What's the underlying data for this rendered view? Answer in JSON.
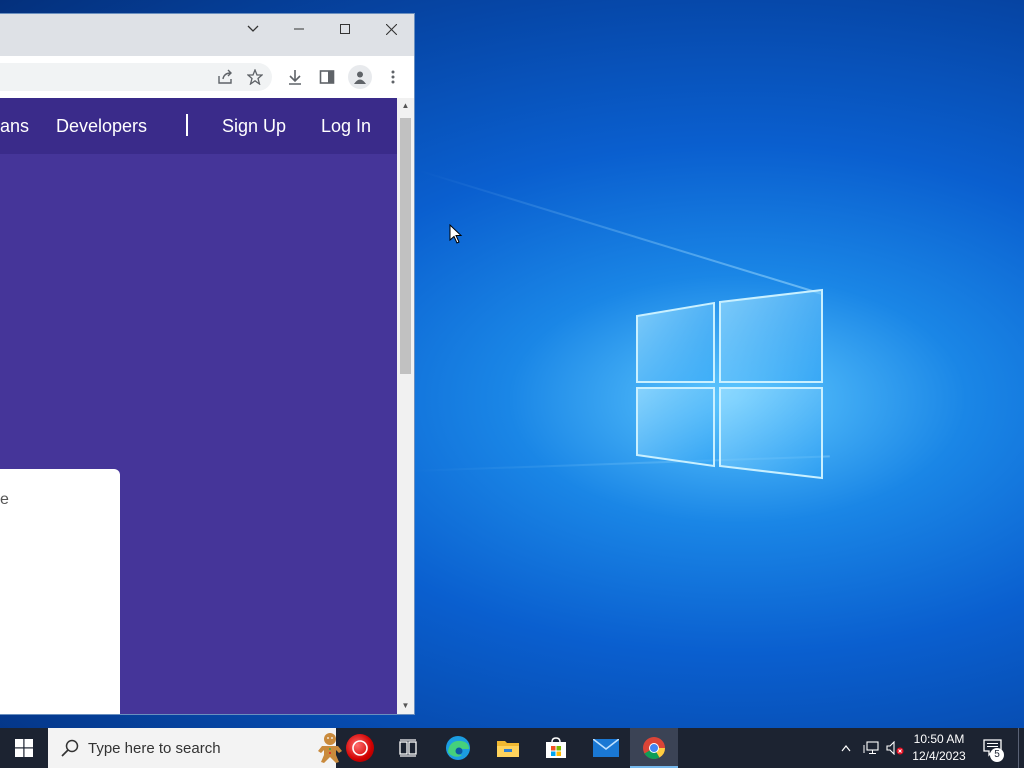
{
  "desktop": {
    "logo_icon": "windows-logo-icon"
  },
  "browser": {
    "controls": {
      "tab_search_icon": "chevron-down-icon",
      "minimize_icon": "minimize-icon",
      "maximize_icon": "maximize-icon",
      "close_icon": "close-icon"
    },
    "toolbar": {
      "share_icon": "share-icon",
      "bookmark_icon": "star-icon",
      "download_icon": "download-icon",
      "side_panel_icon": "side-panel-icon",
      "profile_icon": "profile-icon",
      "menu_icon": "kebab-menu-icon"
    },
    "site": {
      "nav_partial": "ans",
      "nav_developers": "Developers",
      "nav_signup": "Sign Up",
      "nav_login": "Log In",
      "card_text": "e",
      "nav_bg": "#3a2b8a",
      "body_bg": "#453599"
    }
  },
  "taskbar": {
    "search_placeholder": "Type here to search",
    "apps": [
      "cortana-icon",
      "task-view-icon",
      "edge-icon",
      "file-explorer-icon",
      "store-icon",
      "mail-icon",
      "chrome-icon"
    ],
    "active_app": "chrome-icon",
    "clock_time": "10:50 AM",
    "clock_date": "12/4/2023",
    "notification_count": "5",
    "bg": "#1c2331"
  }
}
